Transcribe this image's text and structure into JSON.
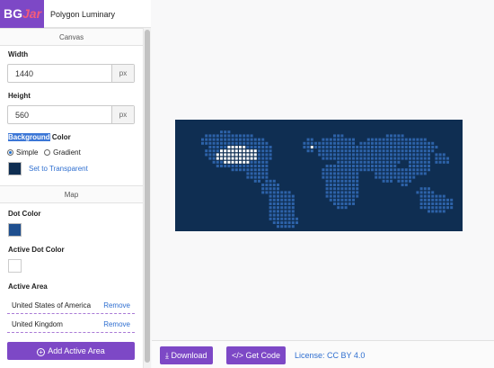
{
  "brand": {
    "logo_bg": "BG",
    "logo_jar": "Jar",
    "title": "Polygon Luminary"
  },
  "canvas_section": {
    "title": "Canvas",
    "width_label": "Width",
    "width_value": "1440",
    "width_unit": "px",
    "height_label": "Height",
    "height_value": "560",
    "height_unit": "px",
    "bg_color_label_highlight": "Background",
    "bg_color_label_rest": " Color",
    "radio_simple": "Simple",
    "radio_gradient": "Gradient",
    "selected_mode": "Simple",
    "bg_color": "#0f2e52",
    "transparent_link": "Set to Transparent"
  },
  "map_section": {
    "title": "Map",
    "dot_color_label": "Dot Color",
    "dot_color": "#1f4f8f",
    "active_dot_color_label": "Active Dot Color",
    "active_dot_color": "#ffffff",
    "active_area_label": "Active Area",
    "areas": [
      {
        "name": "United States of America",
        "remove": "Remove"
      },
      {
        "name": "United Kingdom",
        "remove": "Remove"
      }
    ],
    "add_button": "Add Active Area"
  },
  "bottom": {
    "download": "Download",
    "get_code": "Get Code",
    "license": "License: CC BY 4.0"
  },
  "colors": {
    "accent": "#7d48c6",
    "link": "#2f6fd0",
    "map_bg": "#0f2e52",
    "dot": "#2d62a8",
    "active_dot": "#ffffff"
  }
}
